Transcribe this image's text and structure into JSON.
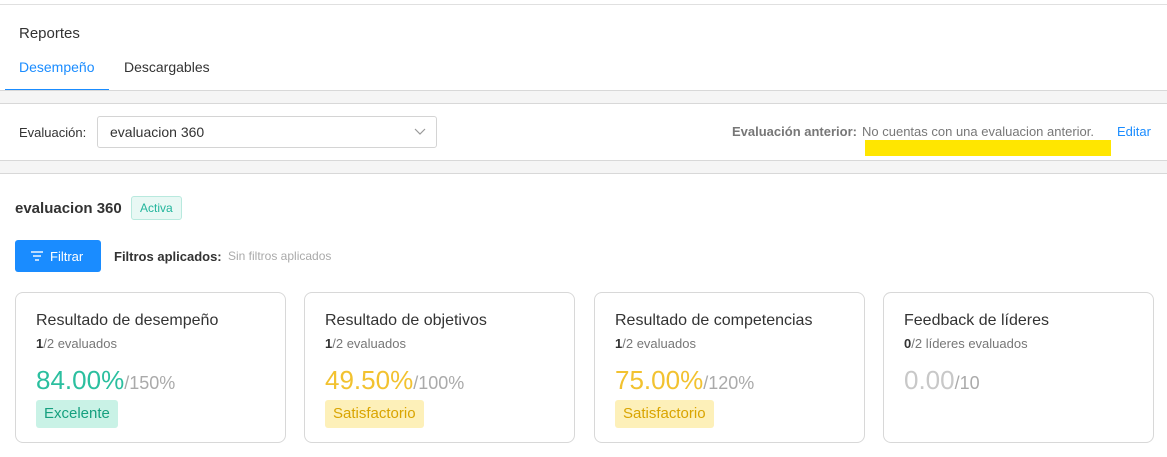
{
  "header": {
    "title": "Reportes",
    "tabs": [
      {
        "label": "Desempeño",
        "active": true
      },
      {
        "label": "Descargables",
        "active": false
      }
    ]
  },
  "evaluation": {
    "label": "Evaluación:",
    "selected": "evaluacion 360",
    "previous_label": "Evaluación anterior:",
    "previous_value": "No cuentas con una evaluacion anterior.",
    "edit_label": "Editar"
  },
  "summary": {
    "name": "evaluacion 360",
    "status": "Activa",
    "filter_button": "Filtrar",
    "applied_label": "Filtros aplicados:",
    "applied_value": "Sin filtros aplicados"
  },
  "cards": [
    {
      "title": "Resultado de desempeño",
      "count": "1",
      "sub": "/2 evaluados",
      "score": "84.00%",
      "max": "/150%",
      "badge": "Excelente",
      "color": "#2bbf9f",
      "badge_bg": "#c9f2e6",
      "badge_fg": "#16a07f"
    },
    {
      "title": "Resultado de objetivos",
      "count": "1",
      "sub": "/2 evaluados",
      "score": "49.50%",
      "max": "/100%",
      "badge": "Satisfactorio",
      "color": "#f2c230",
      "badge_bg": "#fdf0b9",
      "badge_fg": "#d9a400"
    },
    {
      "title": "Resultado de competencias",
      "count": "1",
      "sub": "/2 evaluados",
      "score": "75.00%",
      "max": "/120%",
      "badge": "Satisfactorio",
      "color": "#f2c230",
      "badge_bg": "#fdf0b9",
      "badge_fg": "#d9a400"
    },
    {
      "title": "Feedback de líderes",
      "count": "0",
      "sub": "/2 líderes evaluados",
      "score": "0.00",
      "max": "/10",
      "badge": "",
      "color": "#c8c8c8"
    }
  ],
  "colors": {
    "accent": "#1a8cff",
    "highlight": "#ffe600"
  }
}
